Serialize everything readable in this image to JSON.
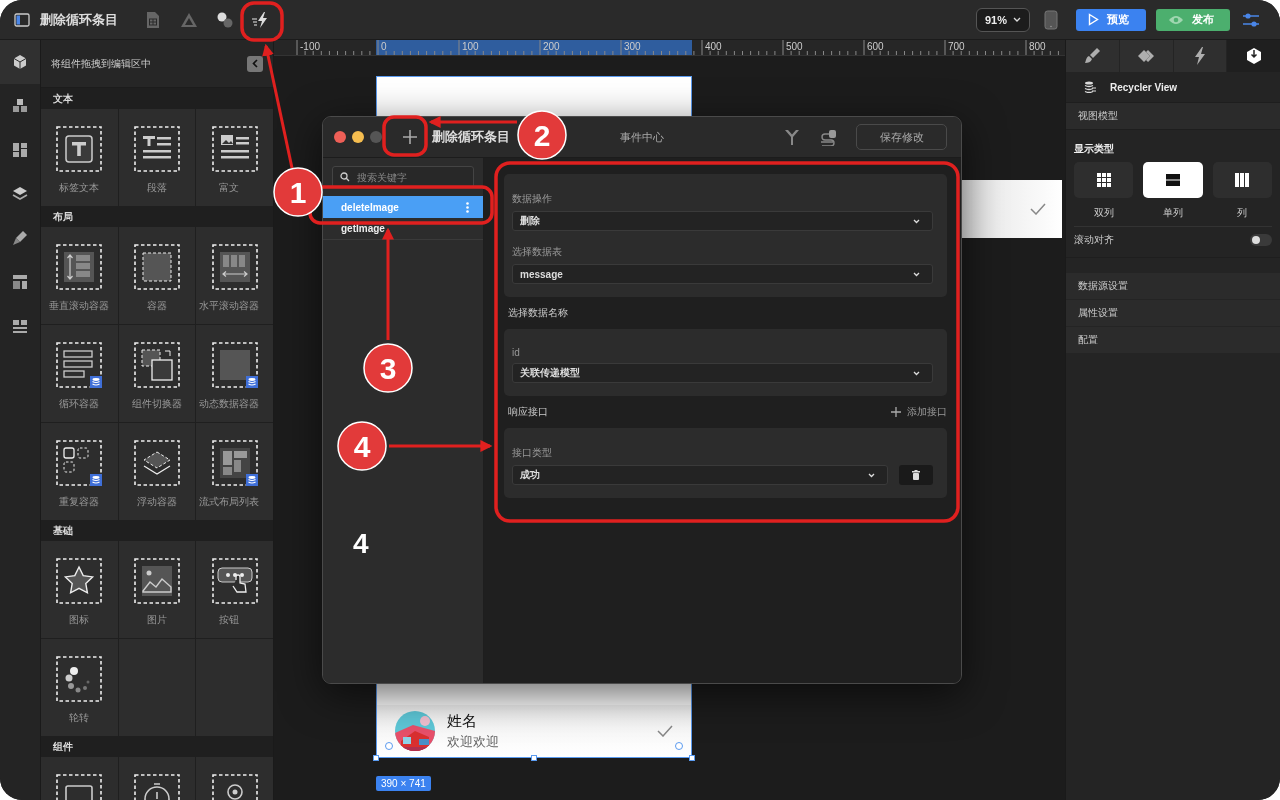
{
  "topbar": {
    "title": "删除循环条目",
    "zoom": "91%",
    "preview_button": "预览",
    "publish_button": "发布"
  },
  "rail": [
    {
      "selected": true
    },
    {
      "selected": false
    },
    {
      "selected": false
    },
    {
      "selected": false
    },
    {
      "selected": false
    },
    {
      "selected": false
    },
    {
      "selected": false
    }
  ],
  "component_panel": {
    "hint": "将组件拖拽到编辑区中",
    "categories": [
      {
        "title": "文本",
        "items": [
          {
            "label": "标签文本",
            "data_badge": false
          },
          {
            "label": "段落",
            "data_badge": false
          },
          {
            "label": "富文",
            "data_badge": false
          }
        ]
      },
      {
        "title": "布局",
        "items": [
          {
            "label": "垂直滚动容器",
            "data_badge": false
          },
          {
            "label": "容器",
            "data_badge": false
          },
          {
            "label": "水平滚动容器",
            "data_badge": false
          },
          {
            "label": "循环容器",
            "data_badge": true
          },
          {
            "label": "组件切换器",
            "data_badge": false
          },
          {
            "label": "动态数据容器",
            "data_badge": true
          },
          {
            "label": "重复容器",
            "data_badge": true
          },
          {
            "label": "浮动容器",
            "data_badge": false
          },
          {
            "label": "流式布局列表",
            "data_badge": true
          }
        ]
      },
      {
        "title": "基础",
        "items": [
          {
            "label": "图标",
            "data_badge": false
          },
          {
            "label": "图片",
            "data_badge": false
          },
          {
            "label": "按钮",
            "data_badge": false
          },
          {
            "label": "轮转",
            "data_badge": false
          }
        ]
      },
      {
        "title": "组件",
        "items": [
          {
            "data_badge": false
          },
          {
            "data_badge": false
          },
          {
            "data_badge": false
          }
        ]
      }
    ]
  },
  "ruler": [
    "-100",
    "0",
    "100",
    "200",
    "300",
    "400",
    "500",
    "600",
    "700",
    "800"
  ],
  "canvas": {
    "list_row": {
      "name": "姓名",
      "subtitle": "欢迎欢迎"
    },
    "size_badge": "390 × 741"
  },
  "event_dialog": {
    "title": "删除循环条目",
    "heading": "事件中心",
    "save_button": "保存修改",
    "search": {
      "placeholder": "搜索关键字"
    },
    "events": [
      {
        "name": "deleteImage",
        "selected": true
      },
      {
        "name": "getImage",
        "selected": false
      }
    ],
    "form": [
      {
        "kind": "card",
        "fields": [
          {
            "label": "数据操作",
            "value": "删除",
            "deletable": false
          },
          {
            "label": "选择数据表",
            "value": "message",
            "deletable": false
          }
        ]
      },
      {
        "kind": "heading",
        "text": "选择数据名称"
      },
      {
        "kind": "card",
        "fields": [
          {
            "label": "id",
            "value": "关联传递模型",
            "deletable": false
          }
        ]
      },
      {
        "kind": "heading",
        "text": "响应接口",
        "action": "添加接口"
      },
      {
        "kind": "card",
        "fields": [
          {
            "label": "接口类型",
            "value": "成功",
            "deletable": true
          }
        ]
      }
    ]
  },
  "props_panel": {
    "tabs": [
      {
        "selected": false
      },
      {
        "selected": false
      },
      {
        "selected": false
      },
      {
        "selected": true
      }
    ],
    "component": "Recycler View",
    "section": "视图模型",
    "display_label": "显示类型",
    "display_options": [
      {
        "label": "双列",
        "selected": false
      },
      {
        "label": "单列",
        "selected": true
      },
      {
        "label": "列",
        "selected": false
      }
    ],
    "scroll_align": {
      "label": "滚动对齐",
      "on": false
    },
    "sections": [
      "数据源设置",
      "属性设置",
      "配置"
    ]
  },
  "annotations": {
    "callouts": [
      {
        "label": "1"
      },
      {
        "label": "2"
      },
      {
        "label": "3"
      },
      {
        "label": "4"
      }
    ],
    "stray_label": "4"
  }
}
